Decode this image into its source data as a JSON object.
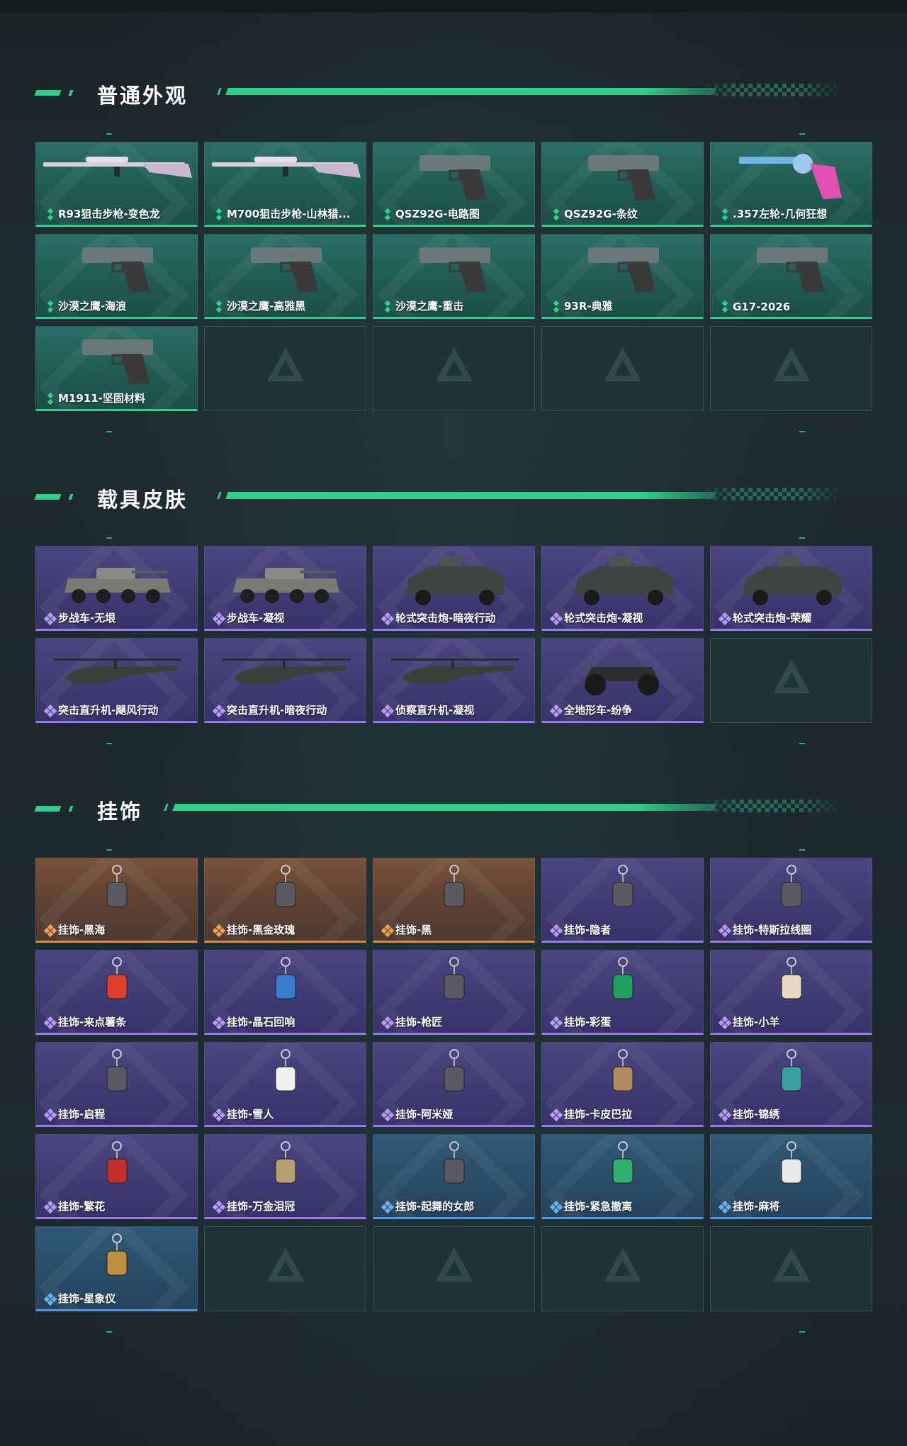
{
  "sections": [
    {
      "title": "普通外观",
      "items": [
        {
          "label": "R93狙击步枪-变色龙",
          "rarity": "green",
          "icon": "sniper-rifle-icon"
        },
        {
          "label": "M700狙击步枪-山林猎...",
          "rarity": "green",
          "icon": "sniper-rifle-icon"
        },
        {
          "label": "QSZ92G-电路图",
          "rarity": "green",
          "icon": "pistol-icon"
        },
        {
          "label": "QSZ92G-条纹",
          "rarity": "green",
          "icon": "pistol-icon"
        },
        {
          "label": ".357左轮-几何狂想",
          "rarity": "green",
          "icon": "revolver-icon"
        },
        {
          "label": "沙漠之鹰-海浪",
          "rarity": "green",
          "icon": "pistol-icon"
        },
        {
          "label": "沙漠之鹰-高雅黑",
          "rarity": "green",
          "icon": "pistol-icon"
        },
        {
          "label": "沙漠之鹰-重击",
          "rarity": "green",
          "icon": "pistol-icon"
        },
        {
          "label": "93R-典雅",
          "rarity": "green",
          "icon": "pistol-icon"
        },
        {
          "label": "G17-2026",
          "rarity": "green",
          "icon": "pistol-icon"
        },
        {
          "label": "M1911-坚固材料",
          "rarity": "green",
          "icon": "pistol-icon"
        }
      ]
    },
    {
      "title": "载具皮肤",
      "items": [
        {
          "label": "步战车-无垠",
          "rarity": "purple",
          "icon": "ifv-icon"
        },
        {
          "label": "步战车-凝视",
          "rarity": "purple",
          "icon": "ifv-icon"
        },
        {
          "label": "轮式突击炮-暗夜行动",
          "rarity": "purple",
          "icon": "armored-car-icon"
        },
        {
          "label": "轮式突击炮-凝视",
          "rarity": "purple",
          "icon": "armored-car-icon"
        },
        {
          "label": "轮式突击炮-荣耀",
          "rarity": "purple",
          "icon": "armored-car-icon"
        },
        {
          "label": "突击直升机-飓风行动",
          "rarity": "purple",
          "icon": "helicopter-icon"
        },
        {
          "label": "突击直升机-暗夜行动",
          "rarity": "purple",
          "icon": "helicopter-icon"
        },
        {
          "label": "侦察直升机-凝视",
          "rarity": "purple",
          "icon": "helicopter-icon"
        },
        {
          "label": "全地形车-纷争",
          "rarity": "purple",
          "icon": "atv-icon"
        }
      ]
    },
    {
      "title": "挂饰",
      "items": [
        {
          "label": "挂饰-黑海",
          "rarity": "orange",
          "icon": "charm-anchor-icon"
        },
        {
          "label": "挂饰-黑金玫瑰",
          "rarity": "orange",
          "icon": "charm-rose-icon"
        },
        {
          "label": "挂饰-黑",
          "rarity": "orange",
          "icon": "charm-tag-icon"
        },
        {
          "label": "挂饰-隐者",
          "rarity": "purple",
          "icon": "charm-card-icon"
        },
        {
          "label": "挂饰-特斯拉线圈",
          "rarity": "purple",
          "icon": "charm-coil-icon"
        },
        {
          "label": "挂饰-来点薯条",
          "rarity": "purple",
          "icon": "charm-fries-icon"
        },
        {
          "label": "挂饰-晶石回响",
          "rarity": "purple",
          "icon": "charm-crystal-icon"
        },
        {
          "label": "挂饰-枪匠",
          "rarity": "purple",
          "icon": "charm-case-icon"
        },
        {
          "label": "挂饰-彩蛋",
          "rarity": "purple",
          "icon": "charm-egg-icon"
        },
        {
          "label": "挂饰-小羊",
          "rarity": "purple",
          "icon": "charm-sheep-icon"
        },
        {
          "label": "挂饰-启程",
          "rarity": "purple",
          "icon": "charm-medal-icon"
        },
        {
          "label": "挂饰-雪人",
          "rarity": "purple",
          "icon": "charm-snowman-icon"
        },
        {
          "label": "挂饰-阿米娅",
          "rarity": "purple",
          "icon": "charm-bunny-icon"
        },
        {
          "label": "挂饰-卡皮巴拉",
          "rarity": "purple",
          "icon": "charm-capybara-icon"
        },
        {
          "label": "挂饰-锦绣",
          "rarity": "purple",
          "icon": "charm-butterfly-icon"
        },
        {
          "label": "挂饰-繁花",
          "rarity": "purple",
          "icon": "charm-flower-icon"
        },
        {
          "label": "挂饰-万金泪冠",
          "rarity": "purple",
          "icon": "charm-crown-icon"
        },
        {
          "label": "挂饰-起舞的女郎",
          "rarity": "blue",
          "icon": "charm-dancer-icon"
        },
        {
          "label": "挂饰-紧急撤离",
          "rarity": "blue",
          "icon": "charm-exit-icon"
        },
        {
          "label": "挂饰-麻将",
          "rarity": "blue",
          "icon": "charm-mahjong-icon"
        },
        {
          "label": "挂饰-星象仪",
          "rarity": "blue",
          "icon": "charm-astrolabe-icon"
        }
      ]
    }
  ],
  "colors": {
    "accent": "#2fd08a",
    "green_rarity": "#2fd08a",
    "purple_rarity": "#9a7ae6",
    "orange_rarity": "#e08a3a",
    "blue_rarity": "#4d9ae0"
  }
}
